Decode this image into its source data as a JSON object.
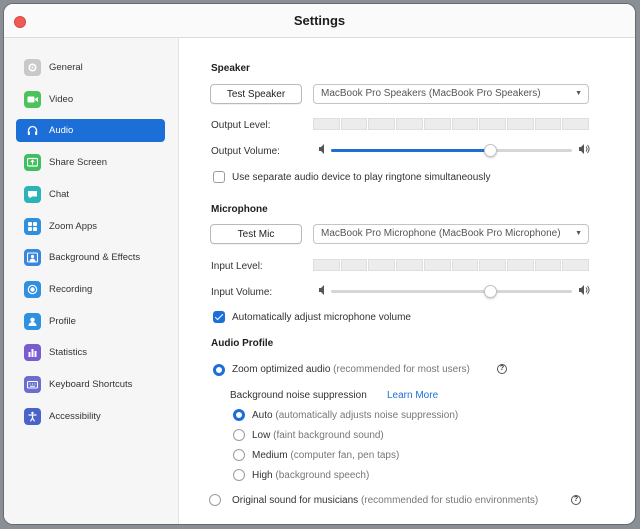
{
  "window": {
    "title": "Settings"
  },
  "sidebar": {
    "items": [
      {
        "label": "General",
        "icon": "gear-icon",
        "color": "#c9c9c9",
        "active": false
      },
      {
        "label": "Video",
        "icon": "video-camera-icon",
        "color": "#4cc25a",
        "active": false
      },
      {
        "label": "Audio",
        "icon": "headphones-icon",
        "color": "#1d6fd8",
        "active": true
      },
      {
        "label": "Share Screen",
        "icon": "share-screen-icon",
        "color": "#3fbf5f",
        "active": false
      },
      {
        "label": "Chat",
        "icon": "chat-bubble-icon",
        "color": "#2ab3b8",
        "active": false
      },
      {
        "label": "Zoom Apps",
        "icon": "apps-icon",
        "color": "#2f8fe0",
        "active": false
      },
      {
        "label": "Background & Effects",
        "icon": "background-icon",
        "color": "#3a86de",
        "active": false
      },
      {
        "label": "Recording",
        "icon": "record-icon",
        "color": "#2f8fe0",
        "active": false
      },
      {
        "label": "Profile",
        "icon": "profile-icon",
        "color": "#2f8fe0",
        "active": false
      },
      {
        "label": "Statistics",
        "icon": "statistics-icon",
        "color": "#7a5cd0",
        "active": false
      },
      {
        "label": "Keyboard Shortcuts",
        "icon": "keyboard-icon",
        "color": "#6a6fcf",
        "active": false
      },
      {
        "label": "Accessibility",
        "icon": "accessibility-icon",
        "color": "#4a63c8",
        "active": false
      }
    ]
  },
  "speaker": {
    "title": "Speaker",
    "test_button": "Test Speaker",
    "device": "MacBook Pro Speakers (MacBook Pro Speakers)",
    "output_level_label": "Output Level:",
    "output_volume_label": "Output Volume:",
    "output_volume_fraction": 0.66,
    "separate_device_label": "Use separate audio device to play ringtone simultaneously",
    "separate_device_checked": false
  },
  "microphone": {
    "title": "Microphone",
    "test_button": "Test Mic",
    "device": "MacBook Pro Microphone (MacBook Pro Microphone)",
    "input_level_label": "Input Level:",
    "input_volume_label": "Input Volume:",
    "input_volume_fraction": 0.66,
    "auto_adjust_label": "Automatically adjust microphone volume",
    "auto_adjust_checked": true
  },
  "audio_profile": {
    "title": "Audio Profile",
    "zoom_optimized_label": "Zoom optimized audio",
    "zoom_optimized_hint": "(recommended for most users)",
    "noise_suppression_label": "Background noise suppression",
    "learn_more": "Learn More",
    "noise_options": [
      {
        "label": "Auto",
        "hint": "(automatically adjusts noise suppression)",
        "selected": true
      },
      {
        "label": "Low",
        "hint": "(faint background sound)",
        "selected": false
      },
      {
        "label": "Medium",
        "hint": "(computer fan, pen taps)",
        "selected": false
      },
      {
        "label": "High",
        "hint": "(background speech)",
        "selected": false
      }
    ],
    "original_sound_label": "Original sound for musicians",
    "original_sound_hint": "(recommended for studio environments)",
    "help_glyph": "?"
  },
  "colors": {
    "accent": "#1d6fd8",
    "close": "#ee5b54"
  }
}
